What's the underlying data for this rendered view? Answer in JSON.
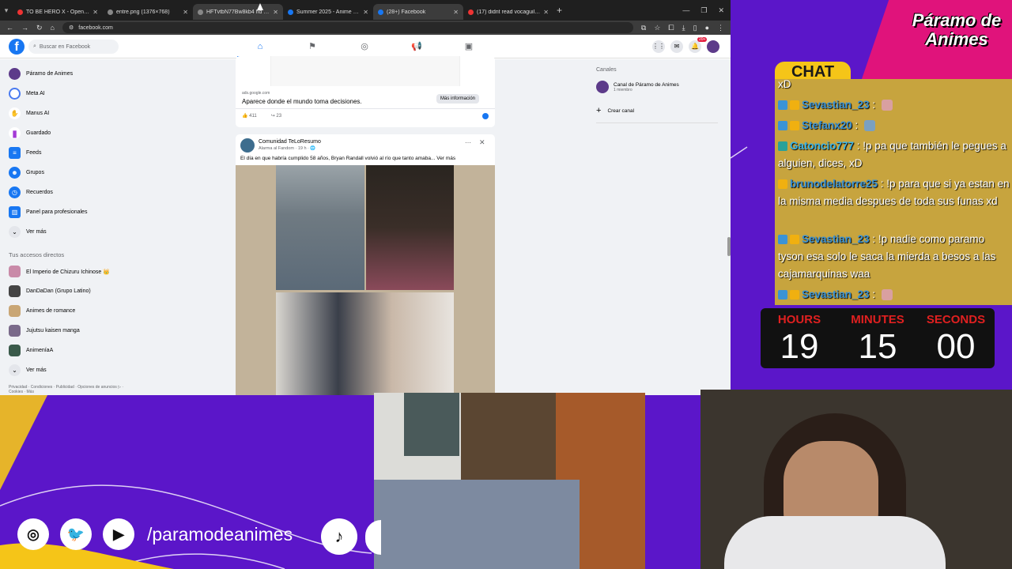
{
  "browser": {
    "tabs": [
      {
        "title": "TO BE HERO X - Opening (INST",
        "active": false
      },
      {
        "title": "entre.png (1376×768)",
        "active": false
      },
      {
        "title": "HFTvtbN77Bw8kb4 hd 1080p",
        "active": true
      },
      {
        "title": "Summer 2025 - Anime - MyAni",
        "active": false
      },
      {
        "title": "(28+) Facebook",
        "active": false
      },
      {
        "title": "(17) didnt read vocaguil and m",
        "active": false
      }
    ],
    "url": "facebook.com"
  },
  "facebook": {
    "search_placeholder": "Buscar en Facebook",
    "notif_count": "20+",
    "left_nav": [
      {
        "label": "Páramo de Animes",
        "icon": "page-avatar-icon"
      },
      {
        "label": "Meta AI",
        "icon": "meta-ai-icon"
      },
      {
        "label": "Manus AI",
        "icon": "manus-icon"
      },
      {
        "label": "Guardado",
        "icon": "bookmark-icon"
      },
      {
        "label": "Feeds",
        "icon": "feeds-icon"
      },
      {
        "label": "Grupos",
        "icon": "groups-icon"
      },
      {
        "label": "Recuerdos",
        "icon": "memories-icon"
      },
      {
        "label": "Panel para profesionales",
        "icon": "dashboard-icon"
      },
      {
        "label": "Ver más",
        "icon": "chevron-down-icon"
      }
    ],
    "shortcuts_title": "Tus accesos directos",
    "shortcuts": [
      {
        "label": "El Imperio de Chizuru Ichinose 👑"
      },
      {
        "label": "DanDaDan (Grupo Latino)"
      },
      {
        "label": "Animes de romance"
      },
      {
        "label": "Jujutsu kaisen manga"
      },
      {
        "label": "AnimeníaA"
      },
      {
        "label": "Ver más"
      }
    ],
    "legal": "Privacidad · Condiciones · Publicidad · Opciones de anuncios ▷ · Cookies · Más",
    "ad": {
      "source": "ads.google.com",
      "title": "Aparece donde el mundo toma decisiones.",
      "button": "Más información",
      "likes": "411",
      "shares": "23"
    },
    "post": {
      "page_name": "Comunidad TeLoResumo",
      "meta": "Alarma al Fandom · 19 h · 🌐",
      "text": "El día en que habría cumplido 58 años, Bryan Randall volvió al río que tanto amaba... Ver más"
    },
    "channels": {
      "title": "Canales",
      "name": "Canal de Páramo de Animes",
      "members": "1 miembro",
      "create": "Crear canal"
    }
  },
  "stream": {
    "logo": "Páramo de Animes",
    "chat_title": "CHAT",
    "chat": [
      {
        "user": "",
        "text": "xD"
      },
      {
        "user": "Sevastian_23",
        "text": ""
      },
      {
        "user": "Stefanx20",
        "text": ""
      },
      {
        "user": "Gatoncio777",
        "text": "!p pa que también le pegues a alguien, dices, xD"
      },
      {
        "user": "brunodelatorre25",
        "text": "!p para que si ya estan en la misma media despues de toda sus funas xd"
      },
      {
        "user": "Sevastian_23",
        "text": "!p nadie como paramo tyson esa solo le saca la mierda a besos a las cajamarquinas waa"
      },
      {
        "user": "Sevastian_23",
        "text": ""
      }
    ],
    "timer": {
      "hours_label": "HOURS",
      "minutes_label": "MINUTES",
      "seconds_label": "SECONDS",
      "hours": "19",
      "minutes": "15",
      "seconds": "00"
    },
    "social_handle": "/paramodeanimes"
  }
}
